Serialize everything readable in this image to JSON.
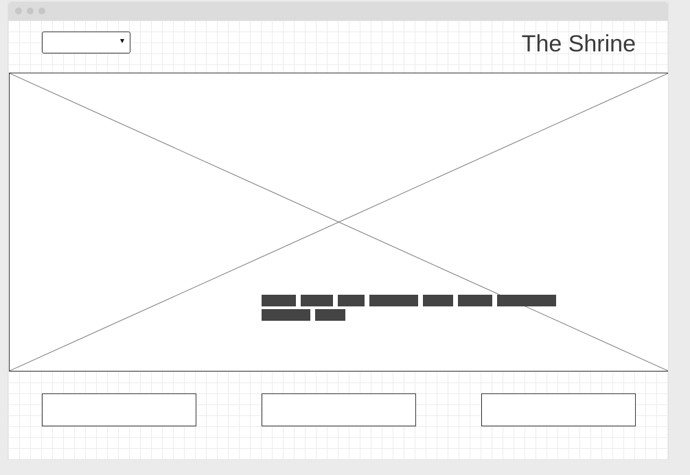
{
  "header": {
    "site_title": "The Shrine",
    "dropdown": {
      "selected": ""
    }
  },
  "window": {
    "controls": [
      "close",
      "minimize",
      "maximize"
    ]
  },
  "hero": {
    "image": "image-placeholder",
    "text_lines": [
      [
        "redacted-word",
        "redacted-word",
        "redacted-word",
        "redacted-word",
        "redacted-word",
        "redacted-word",
        "redacted-word"
      ],
      [
        "redacted-word",
        "redacted-word"
      ]
    ]
  },
  "cards": [
    {
      "label": ""
    },
    {
      "label": ""
    },
    {
      "label": ""
    }
  ],
  "colors": {
    "background": "#ebebeb",
    "grid": "#ececec",
    "border": "#333333",
    "text_block": "#444444",
    "title": "#3a3a3a"
  }
}
